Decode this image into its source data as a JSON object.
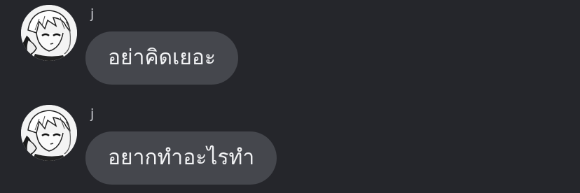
{
  "messages": [
    {
      "sender": "j",
      "text": "อย่าคิดเยอะ",
      "avatar_icon": "anime-avatar"
    },
    {
      "sender": "j",
      "text": "อยากทำอะไรทำ",
      "avatar_icon": "anime-avatar"
    }
  ],
  "colors": {
    "background": "#25262b",
    "bubble": "#45474d",
    "bubble_text": "#f1f2f4",
    "sender_text": "#c9cbd0"
  }
}
